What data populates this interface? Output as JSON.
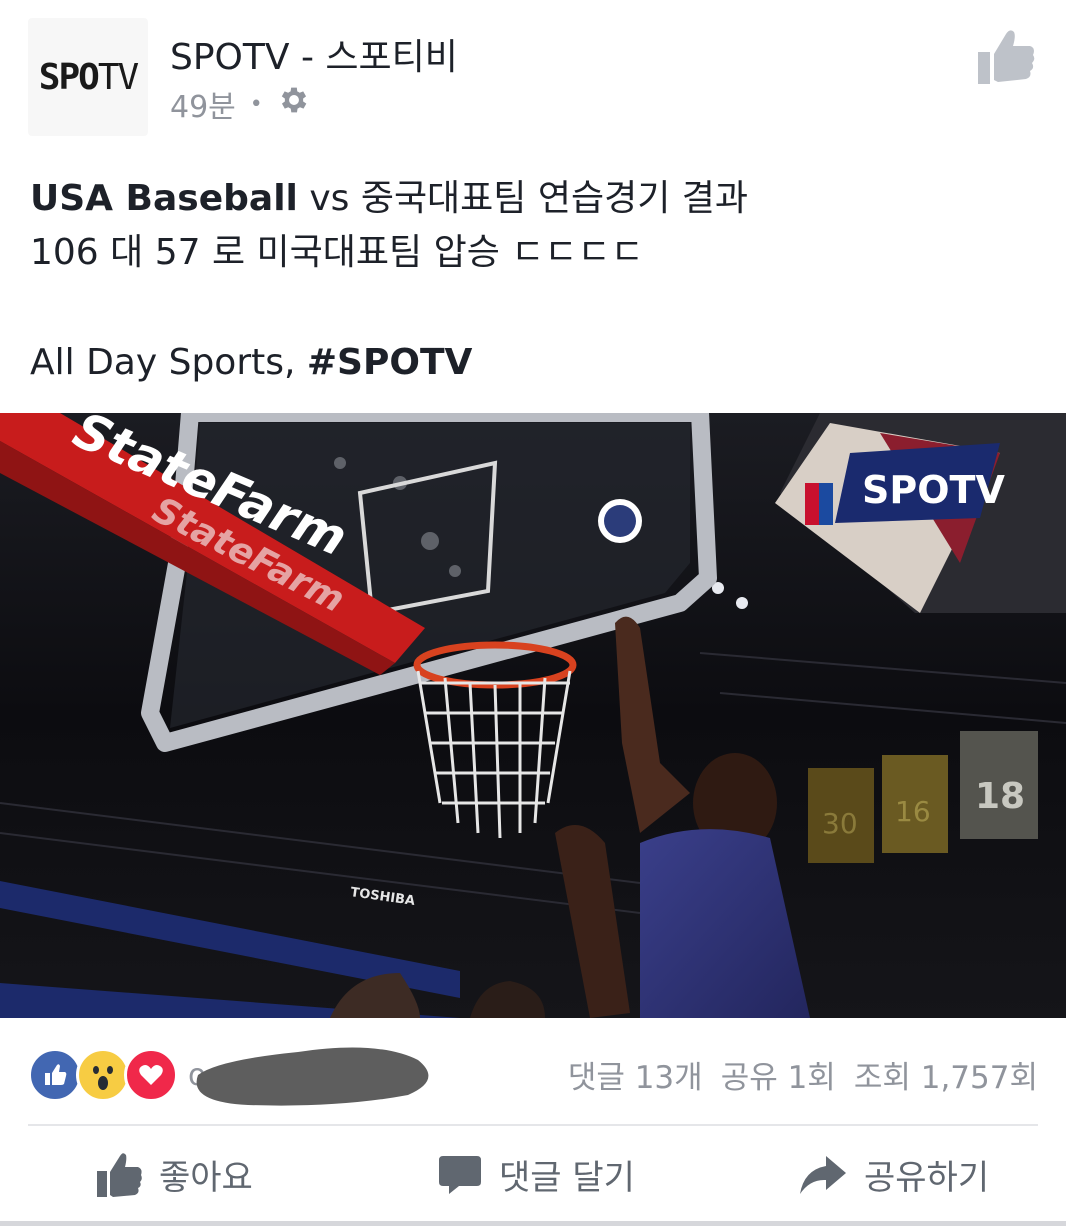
{
  "header": {
    "avatar_text_bold": "SPO",
    "avatar_text_thin": "TV",
    "page_name": "SPOTV - 스포티비",
    "timestamp": "49분",
    "separator": "•"
  },
  "post": {
    "line1_bold": "USA Baseball",
    "line1_rest": " vs 중국대표팀 연습경기 결과",
    "line2": "106 대 57 로 미국대표팀 압승 ㄷㄷㄷㄷ",
    "line3_prefix": "All Day Sports, ",
    "line3_hashtag": "#SPOTV"
  },
  "video": {
    "sponsor_1": "StateFarm",
    "sponsor_2": "StateFarm",
    "watermark": "SPOTV",
    "arena_banner": "TOSHIBA",
    "jersey_1": "30",
    "jersey_2": "16",
    "jersey_3": "18"
  },
  "reactions": {
    "icons": [
      "like-reaction",
      "wow-reaction",
      "love-reaction"
    ],
    "name_prefix": "o",
    "comments": "댓글 13개",
    "shares": "공유 1회",
    "views": "조회 1,757회"
  },
  "actions": {
    "like_label": "좋아요",
    "comment_label": "댓글 달기",
    "share_label": "공유하기"
  },
  "colors": {
    "like_blue": "#4267b2",
    "wow_yellow": "#f7cc43",
    "love_red": "#f0284a",
    "secondary_text": "#90949c"
  }
}
